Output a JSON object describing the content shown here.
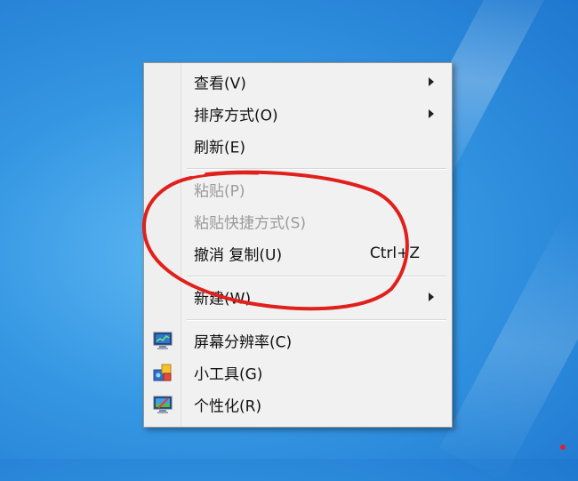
{
  "menu": {
    "items": [
      {
        "label": "查看(V)",
        "submenu": true,
        "disabled": false
      },
      {
        "label": "排序方式(O)",
        "submenu": true,
        "disabled": false
      },
      {
        "label": "刷新(E)",
        "submenu": false,
        "disabled": false
      },
      {
        "label": "粘贴(P)",
        "submenu": false,
        "disabled": true
      },
      {
        "label": "粘贴快捷方式(S)",
        "submenu": false,
        "disabled": true
      },
      {
        "label": "撤消 复制(U)",
        "shortcut": "Ctrl+Z",
        "submenu": false,
        "disabled": false
      },
      {
        "label": "新建(W)",
        "submenu": true,
        "disabled": false
      },
      {
        "label": "屏幕分辨率(C)",
        "icon": "display-settings-icon",
        "submenu": false,
        "disabled": false
      },
      {
        "label": "小工具(G)",
        "icon": "gadgets-icon",
        "submenu": false,
        "disabled": false
      },
      {
        "label": "个性化(R)",
        "icon": "personalize-icon",
        "submenu": false,
        "disabled": false
      }
    ]
  },
  "colors": {
    "annotation": "#e0201c",
    "menu_bg": "#f1f1f1",
    "disabled_text": "#9b9b9b"
  }
}
